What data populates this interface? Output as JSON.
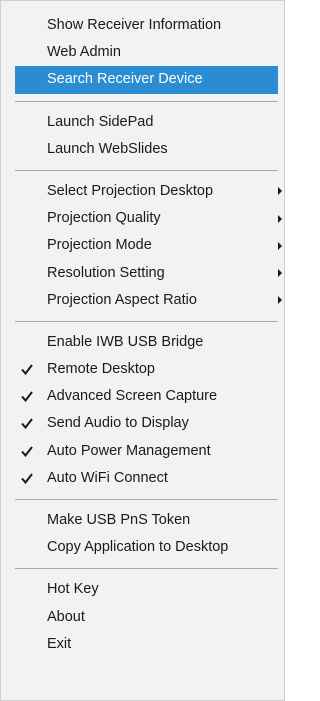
{
  "menu": {
    "groups": [
      [
        {
          "label": "Show Receiver Information"
        },
        {
          "label": "Web Admin"
        },
        {
          "label": "Search Receiver Device",
          "highlighted": true
        }
      ],
      [
        {
          "label": "Launch SidePad"
        },
        {
          "label": "Launch WebSlides"
        }
      ],
      [
        {
          "label": "Select Projection Desktop",
          "submenu": true
        },
        {
          "label": "Projection Quality",
          "submenu": true
        },
        {
          "label": "Projection Mode",
          "submenu": true
        },
        {
          "label": "Resolution Setting",
          "submenu": true
        },
        {
          "label": "Projection Aspect Ratio",
          "submenu": true
        }
      ],
      [
        {
          "label": "Enable IWB USB Bridge"
        },
        {
          "label": "Remote Desktop",
          "checked": true
        },
        {
          "label": "Advanced Screen Capture",
          "checked": true
        },
        {
          "label": "Send Audio to Display",
          "checked": true
        },
        {
          "label": "Auto Power Management",
          "checked": true
        },
        {
          "label": "Auto WiFi Connect",
          "checked": true
        }
      ],
      [
        {
          "label": "Make USB PnS Token"
        },
        {
          "label": "Copy Application to Desktop"
        }
      ],
      [
        {
          "label": "Hot Key"
        },
        {
          "label": "About"
        },
        {
          "label": "Exit"
        }
      ]
    ],
    "icons": {
      "check": "check-icon",
      "submenu": "submenu-arrow-icon"
    },
    "colors": {
      "background": "#f2f2f2",
      "highlight": "#2a8dd4",
      "highlight_text": "#ffffff",
      "separator": "#a8a8a8",
      "text": "#1a1a1a"
    }
  }
}
